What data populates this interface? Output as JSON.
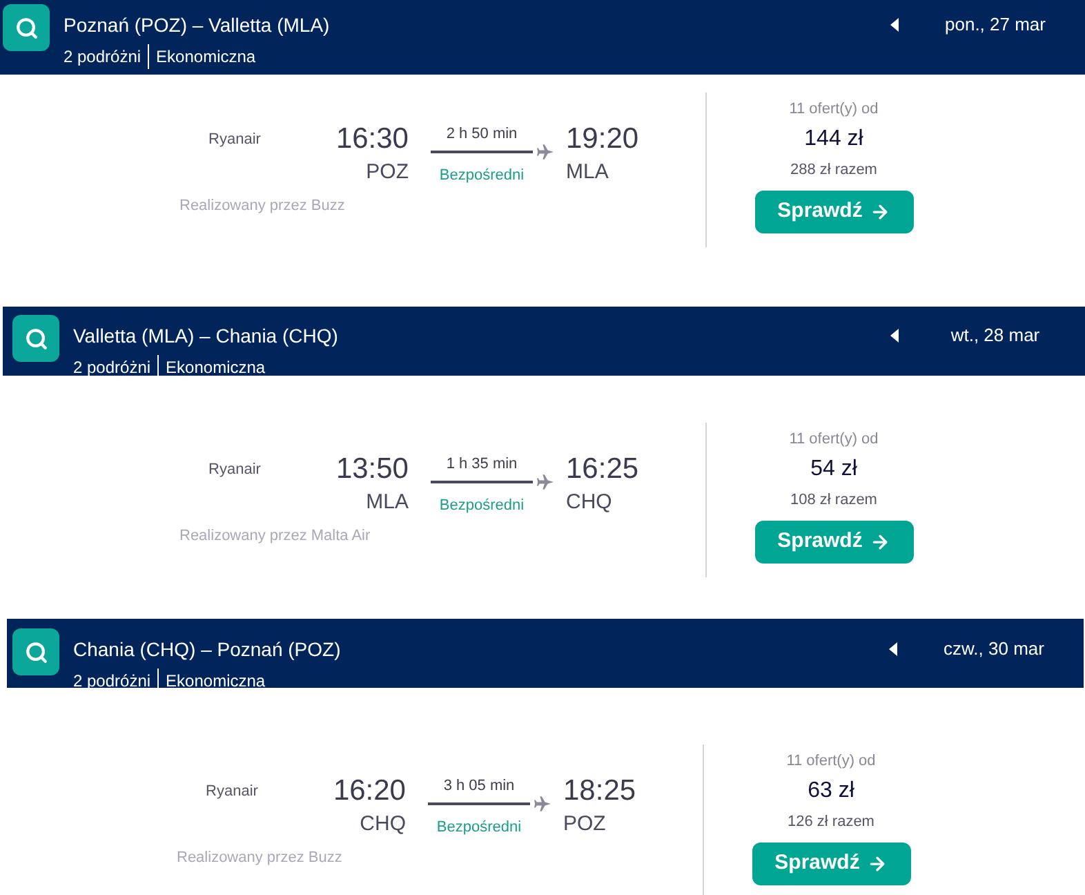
{
  "searches": [
    {
      "route": "Poznań (POZ) – Valletta (MLA)",
      "travelers": "2 podróżni",
      "cabin": "Ekonomiczna",
      "date": "pon., 27 mar",
      "result": {
        "airline": "Ryanair",
        "departure_time": "16:30",
        "departure_airport": "POZ",
        "duration": "2 h 50 min",
        "stops": "Bezpośredni",
        "arrival_time": "19:20",
        "arrival_airport": "MLA",
        "operated_by": "Realizowany przez Buzz",
        "offers": "11 ofert(y) od",
        "price": "144 zł",
        "total": "288 zł razem",
        "button": "Sprawdź"
      }
    },
    {
      "route": "Valletta (MLA) – Chania (CHQ)",
      "travelers": "2 podróżni",
      "cabin": "Ekonomiczna",
      "date": "wt., 28 mar",
      "result": {
        "airline": "Ryanair",
        "departure_time": "13:50",
        "departure_airport": "MLA",
        "duration": "1 h 35 min",
        "stops": "Bezpośredni",
        "arrival_time": "16:25",
        "arrival_airport": "CHQ",
        "operated_by": "Realizowany przez Malta Air",
        "offers": "11 ofert(y) od",
        "price": "54 zł",
        "total": "108 zł razem",
        "button": "Sprawdź"
      }
    },
    {
      "route": "Chania (CHQ) – Poznań (POZ)",
      "travelers": "2 podróżni",
      "cabin": "Ekonomiczna",
      "date": "czw., 30 mar",
      "result": {
        "airline": "Ryanair",
        "departure_time": "16:20",
        "departure_airport": "CHQ",
        "duration": "3 h 05 min",
        "stops": "Bezpośredni",
        "arrival_time": "18:25",
        "arrival_airport": "POZ",
        "operated_by": "Realizowany przez Buzz",
        "offers": "11 ofert(y) od",
        "price": "63 zł",
        "total": "126 zł razem",
        "button": "Sprawdź"
      }
    }
  ]
}
